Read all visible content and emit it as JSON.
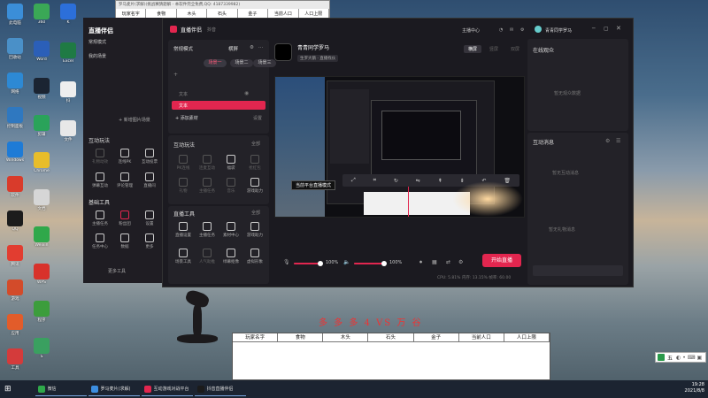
{
  "desktop": {
    "icons": [
      {
        "label": "此电脑",
        "color": "#3b8ed8"
      },
      {
        "label": "回收站",
        "color": "#4a90c8"
      },
      {
        "label": "网络",
        "color": "#2d89d4"
      },
      {
        "label": "控制面板",
        "color": "#2f78c0"
      },
      {
        "label": "Windows",
        "color": "#1e7bd6"
      },
      {
        "label": "软件",
        "color": "#d93b2b"
      },
      {
        "label": "QQ",
        "color": "#1c1c1c"
      },
      {
        "label": "腾讯",
        "color": "#e23d30"
      },
      {
        "label": "游戏",
        "color": "#d34b2a"
      },
      {
        "label": "应用",
        "color": "#e25c2a"
      },
      {
        "label": "工具",
        "color": "#d43b3b"
      }
    ],
    "icons_col2": [
      {
        "label": "360",
        "color": "#3aa856"
      },
      {
        "label": "Word",
        "color": "#2b5fb8"
      },
      {
        "label": "视频",
        "color": "#1b2432"
      },
      {
        "label": "剪辑",
        "color": "#2aa35a"
      },
      {
        "label": "Chrome",
        "color": "#e8bd2a"
      },
      {
        "label": "文档",
        "color": "#d6d6d6"
      },
      {
        "label": "Weixin",
        "color": "#2fa84a"
      },
      {
        "label": "WPS",
        "color": "#d8322b"
      },
      {
        "label": "程序",
        "color": "#3c9d3c"
      },
      {
        "label": "S",
        "color": "#3aa060"
      }
    ],
    "icons_col3": [
      {
        "label": "K",
        "color": "#2c6fd9"
      },
      {
        "label": "Excel",
        "color": "#1f7a44"
      },
      {
        "label": "抖",
        "color": "#eee"
      },
      {
        "label": "文件",
        "color": "#e8e8e8"
      }
    ]
  },
  "notepad": {
    "title": "罗马麦片(求解)(挑战赛猜题解 - 本软件完全免费,QQ: 4187339982)",
    "columns": [
      "玩家名字",
      "食物",
      "木头",
      "石头",
      "金子",
      "当前人口",
      "人口上限"
    ]
  },
  "left_panel": {
    "title": "直播伴侣",
    "title2": "常规模式",
    "title3": "我的场景",
    "new_scene": "+ 新增图片场景",
    "interaction": "互动玩法",
    "basic_tools": "基础工具",
    "more_tools": "更多工具",
    "row1": [
      "礼物动效",
      "连线PK",
      "互动投票"
    ],
    "row2": [
      "弹幕互动",
      "评论管理",
      "直播间"
    ],
    "row3": [
      "主播任务",
      "粉丝团",
      "设置"
    ],
    "row4": [
      "任务中心",
      "数据",
      "更多"
    ]
  },
  "main_window": {
    "title": "直播伴侣",
    "subtitle": "抖音",
    "mode": "常规模式",
    "orientation": "横屏",
    "scenes": [
      "场景一",
      "场景二",
      "场景三"
    ],
    "sources": [
      "文本",
      "文本"
    ],
    "add_material": "+ 添加素材",
    "material_right": "设置",
    "interaction_title": "互动玩法",
    "interaction_all": "全部",
    "interaction_tools": [
      "PK连线",
      "连麦互动",
      "福袋",
      "抢红包",
      "礼物",
      "主播任务",
      "音乐",
      "游戏助力"
    ],
    "live_tools_title": "直播工具",
    "live_tools_all": "全部",
    "live_tools": [
      "直播设置",
      "主播任务",
      "素材中心",
      "游戏助力",
      "场景工具",
      "人气助推",
      "绿幕抠像",
      "虚拟形象"
    ],
    "streamer_name": "青青同学罗马",
    "streamer_badge": "生罗大鹅 · 直播找伙",
    "top_actions": [
      "主播中心",
      "青青同学罗马"
    ],
    "view_tabs": [
      "横屏",
      "竖屏",
      "双屏"
    ],
    "tooltip": "当前平台直播模式",
    "mic_volume": "100%",
    "speaker_volume": "100%",
    "start_live": "开始直播",
    "stats": "CPU: 5.81%   内存: 13.15%   帧率: 60.00"
  },
  "right_panel": {
    "viewers_title": "在线观众",
    "viewers_empty": "暂无观众数据",
    "messages_title": "互动消息",
    "messages_empty": "暂无互动消息",
    "messages_hint": "暂无礼物消息"
  },
  "banner_text": "多 多 多 4 VS 万 谷",
  "game_table": {
    "columns": [
      "玩家名字",
      "食物",
      "木头",
      "石头",
      "金子",
      "当前人口",
      "人口上限"
    ]
  },
  "tray": {
    "ime": "五",
    "time": "19:28",
    "date": "2021/8/8"
  },
  "taskbar": {
    "items": [
      {
        "label": "微信",
        "color": "#2fa84a"
      },
      {
        "label": "罗马麦片(求解)",
        "color": "#3c8ee0"
      },
      {
        "label": "互动游戏对战平台",
        "color": "#e2264f"
      },
      {
        "label": "抖音直播伴侣",
        "color": "#1b1b1b"
      }
    ]
  },
  "colors": {
    "accent": "#e2264f",
    "panel": "#1b1a20"
  }
}
